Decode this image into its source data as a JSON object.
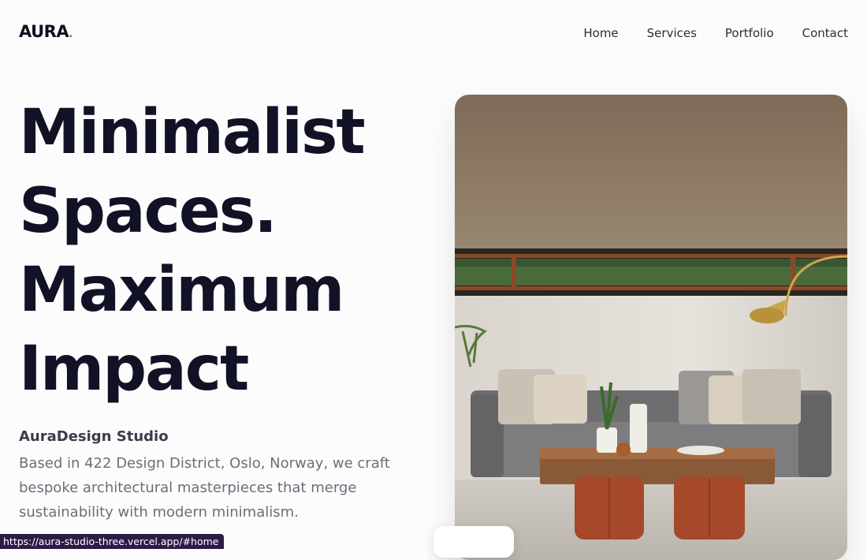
{
  "header": {
    "logo": "AURA",
    "logo_dot": ".",
    "nav": [
      "Home",
      "Services",
      "Portfolio",
      "Contact"
    ]
  },
  "hero": {
    "title_lines": [
      "Minimalist",
      "Spaces.",
      "Maximum",
      "Impact"
    ],
    "studio_name": "AuraDesign Studio",
    "description": "Based in 422 Design District, Oslo, Norway, we craft bespoke architectural masterpieces that merge sustainability with modern minimalism."
  },
  "status_bar": {
    "url": "https://aura-studio-three.vercel.app/#home"
  },
  "colors": {
    "heading": "#121226",
    "body_text": "#6b6e78",
    "status_bar_bg": "#2e1a47"
  }
}
